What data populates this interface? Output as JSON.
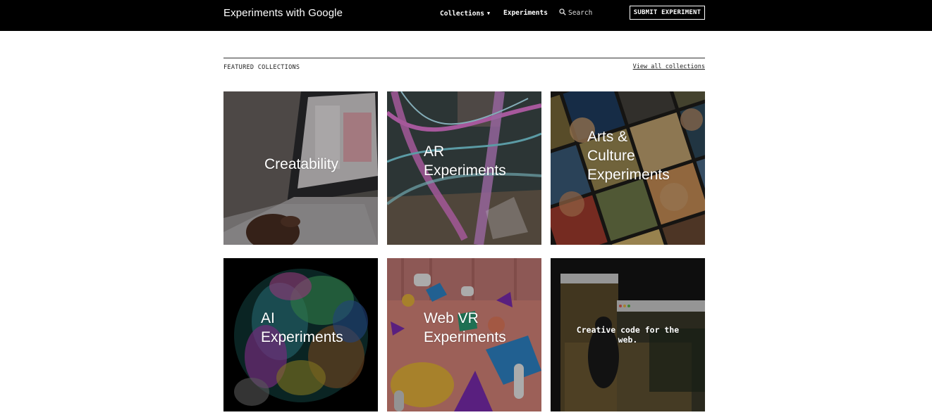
{
  "header": {
    "brand": "Experiments with Google",
    "nav": {
      "collections": "Collections",
      "experiments": "Experiments",
      "search": "Search"
    },
    "submit_label": "SUBMIT EXPERIMENT"
  },
  "featured": {
    "title": "FEATURED COLLECTIONS",
    "view_all": "View all collections"
  },
  "tiles": [
    {
      "label": "Creatability",
      "image": "laptop-typing-photo"
    },
    {
      "label_line1": "AR",
      "label_line2": "Experiments",
      "image": "ar-light-trails"
    },
    {
      "label_line1": "Arts &",
      "label_line2": "Culture",
      "label_line3": "Experiments",
      "image": "painting-portraits-collage"
    },
    {
      "label_line1": "AI",
      "label_line2": "Experiments",
      "image": "ai-point-cloud"
    },
    {
      "label_line1": "Web VR",
      "label_line2": "Experiments",
      "image": "vr-shapes-scene"
    },
    {
      "label_line1": "Creative code for the",
      "label_line2": "web.",
      "image": "browser-windows-photo"
    }
  ],
  "colors": {
    "header_bg": "#000000",
    "page_bg": "#ffffff",
    "text_light": "#ffffff"
  }
}
